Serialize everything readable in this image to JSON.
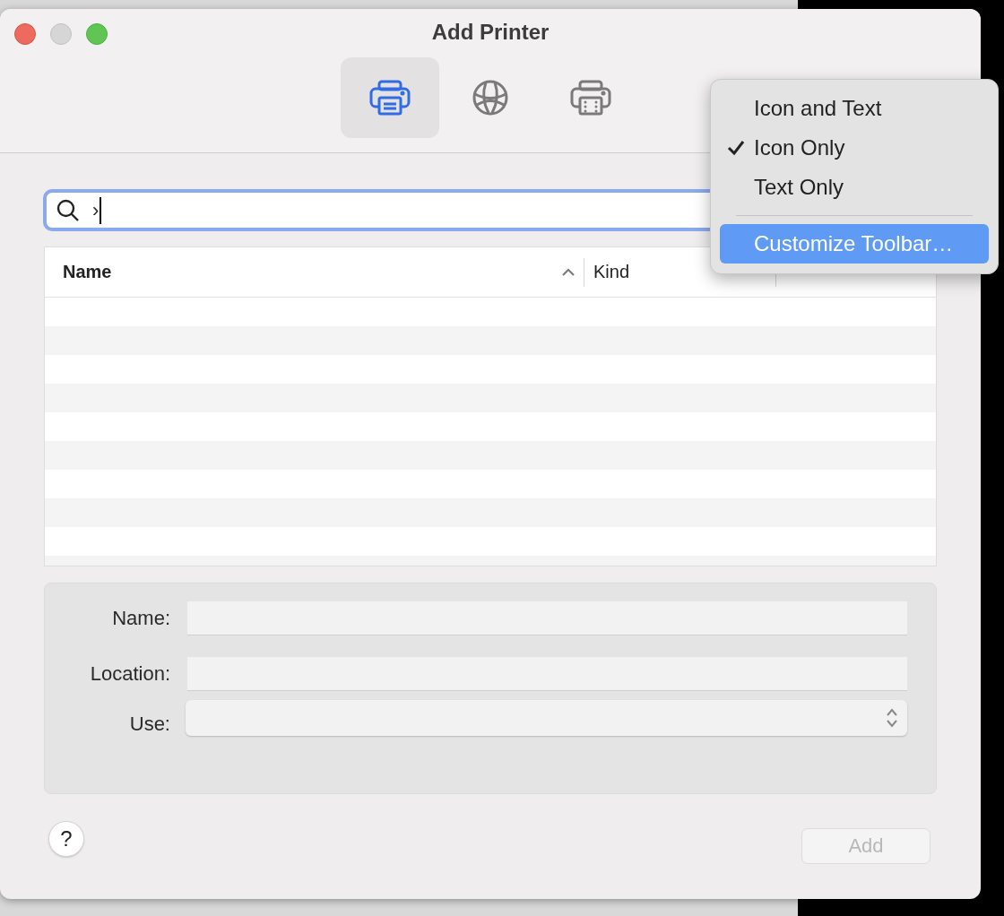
{
  "window": {
    "title": "Add Printer"
  },
  "toolbar": [
    {
      "kind": "printer",
      "selected": true
    },
    {
      "kind": "globe",
      "selected": false
    },
    {
      "kind": "fax",
      "selected": false
    }
  ],
  "search": {
    "value": "›",
    "focused": true
  },
  "table": {
    "columns": [
      {
        "label": "Name",
        "sorted": true
      },
      {
        "label": "Kind",
        "sorted": false
      }
    ]
  },
  "form": {
    "fields": [
      {
        "label": "Name:",
        "kind": "text"
      },
      {
        "label": "Location:",
        "kind": "text"
      },
      {
        "label": "Use:",
        "kind": "popup"
      }
    ]
  },
  "help_button": {
    "label": "?"
  },
  "add_button": {
    "label": "Add",
    "disabled": true
  },
  "context_menu": {
    "items": [
      {
        "kind": "item",
        "label": "Icon and Text",
        "checked": false,
        "selected": false
      },
      {
        "kind": "item",
        "label": "Icon Only",
        "checked": true,
        "selected": false
      },
      {
        "kind": "item",
        "label": "Text Only",
        "checked": false,
        "selected": false
      },
      {
        "kind": "separator"
      },
      {
        "kind": "item",
        "label": "Customize Toolbar…",
        "checked": false,
        "selected": true
      }
    ]
  }
}
